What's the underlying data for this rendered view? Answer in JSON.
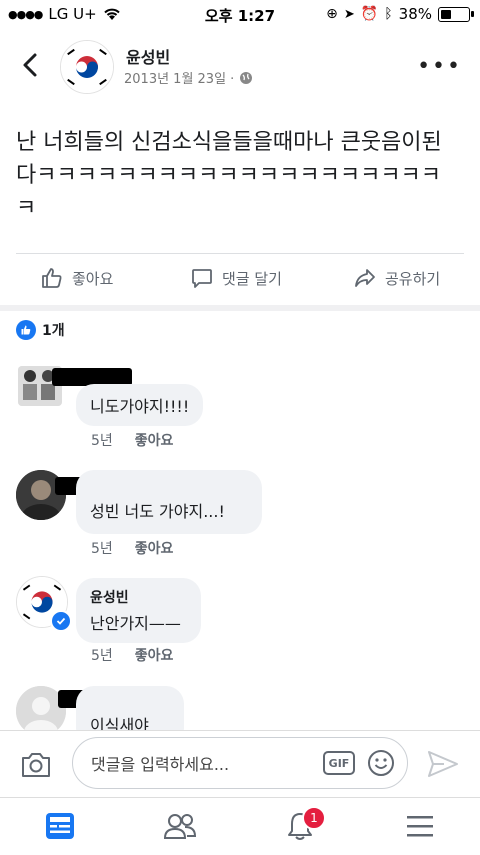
{
  "status_bar": {
    "carrier": "LG U+",
    "time": "오후 1:27",
    "battery": "38%",
    "battery_level": 0.38
  },
  "header": {
    "name": "윤성빈",
    "date": "2013년 1월 23일 ·"
  },
  "post": {
    "text": "난 너희들의 신검소식을들을때마나 큰웃음이된다ㅋㅋㅋㅋㅋㅋㅋㅋㅋㅋㅋㅋㅋㅋㅋㅋㅋㅋㅋㅋㅋ"
  },
  "actions": {
    "like": "좋아요",
    "comment": "댓글 달기",
    "share": "공유하기"
  },
  "reactions": {
    "count": "1개"
  },
  "comments": [
    {
      "text": "니도가야지!!!!",
      "age": "5년",
      "like": "좋아요"
    },
    {
      "text": "성빈 너도 가야지...!",
      "age": "5년",
      "like": "좋아요"
    },
    {
      "name": "윤성빈",
      "text": "난안가지——",
      "age": "5년",
      "like": "좋아요"
    },
    {
      "text": "이식새야"
    }
  ],
  "input": {
    "placeholder": "댓글을 입력하세요...",
    "gif_label": "GIF"
  },
  "tabbar": {
    "notifications_badge": "1"
  },
  "colors": {
    "accent": "#1877f2",
    "badge": "#e41e3f",
    "bubble": "#f0f2f5"
  }
}
